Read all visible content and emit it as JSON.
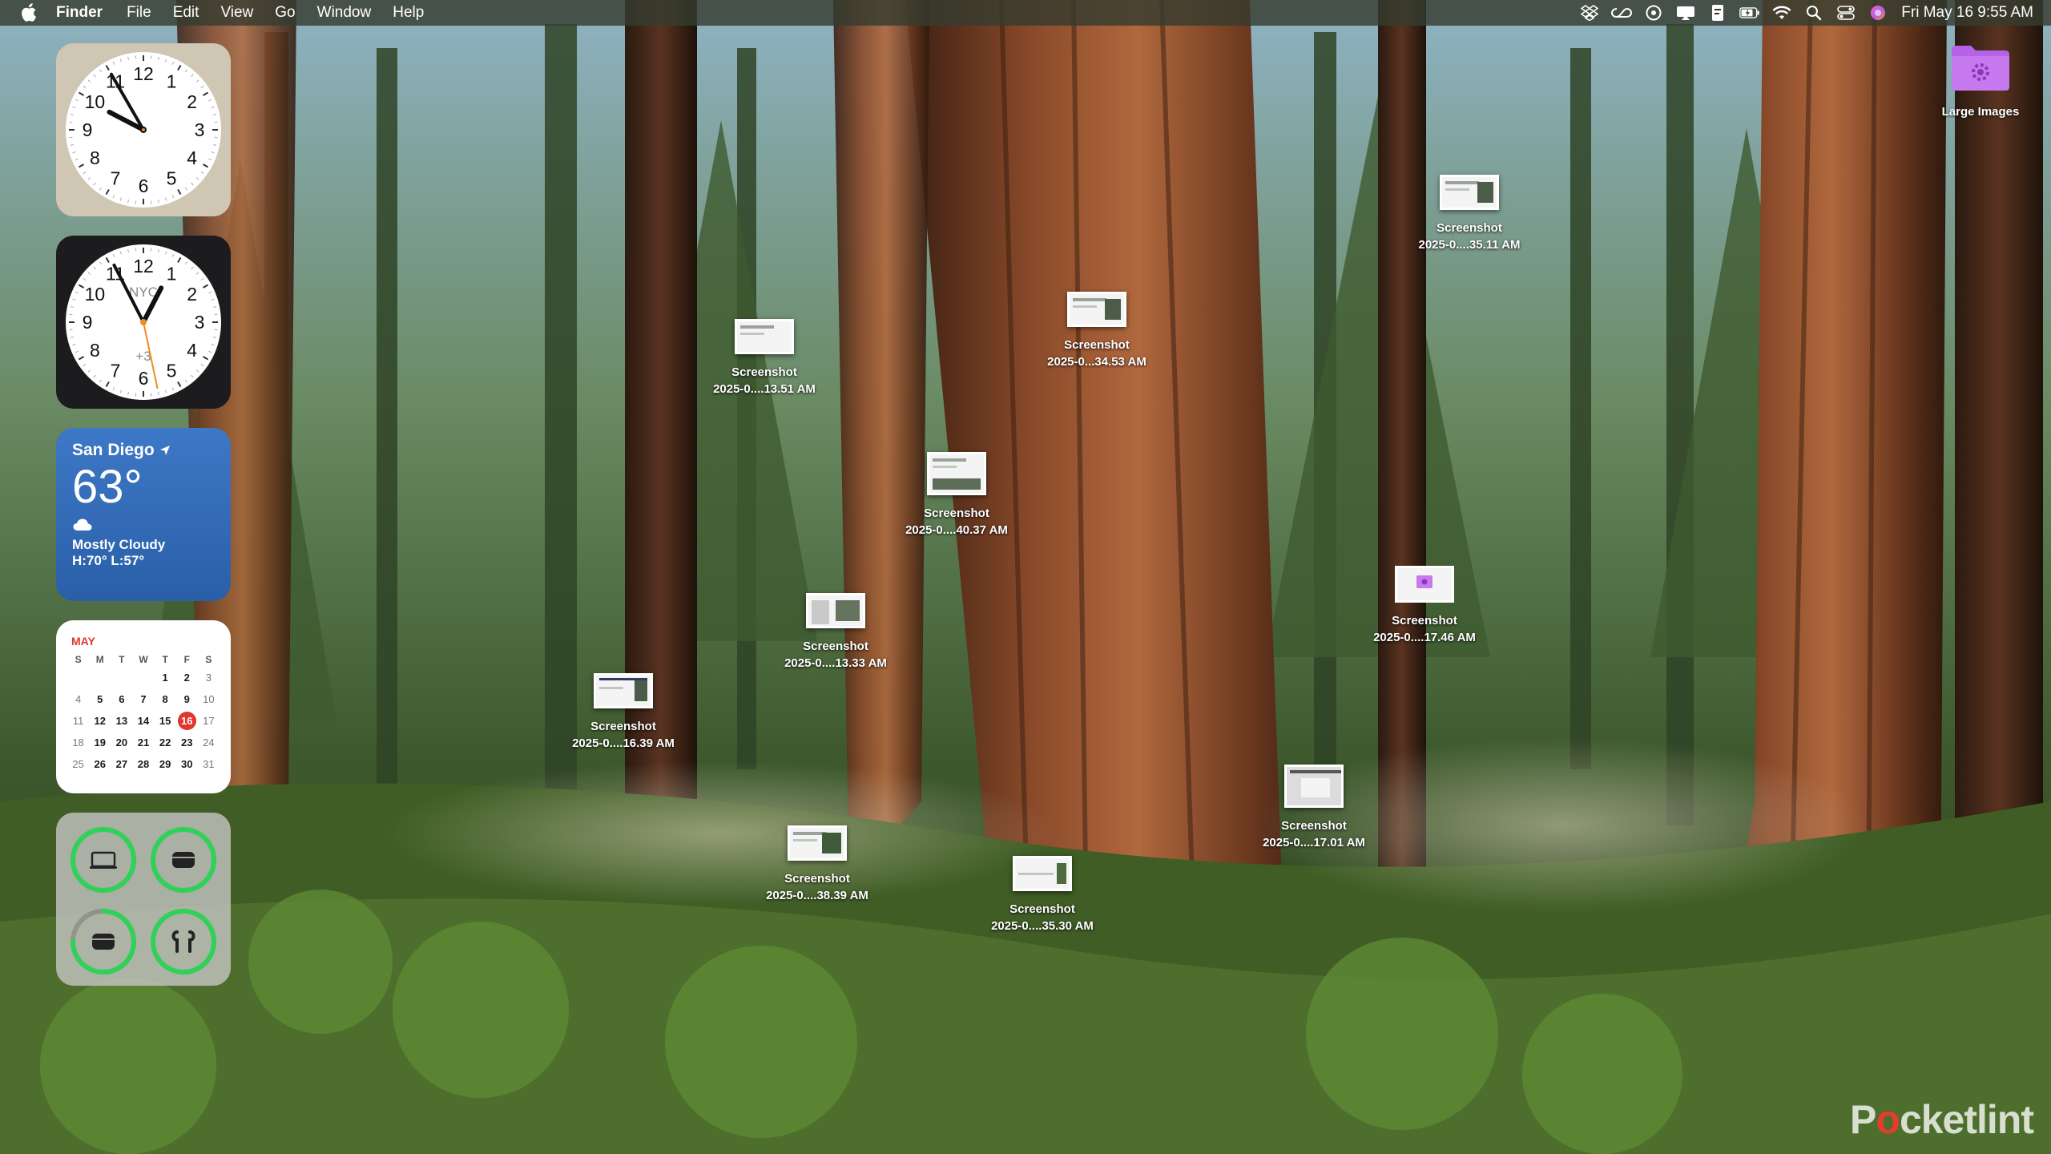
{
  "menubar": {
    "apple_icon": "apple-logo-icon",
    "app_name": "Finder",
    "menus": [
      "File",
      "Edit",
      "View",
      "Go",
      "Window",
      "Help"
    ],
    "status_icons": [
      "dropbox-icon",
      "creative-cloud-icon",
      "copilot-icon",
      "screen-mirroring-icon",
      "document-icon",
      "battery-charging-icon",
      "wifi-icon",
      "search-icon",
      "control-center-icon",
      "siri-icon"
    ],
    "datetime": "Fri May 16  9:55 AM"
  },
  "widgets": {
    "clock_local": {
      "hour": 9,
      "minute": 55,
      "second": 0
    },
    "clock_world": {
      "label": "NYC",
      "offset": "+3",
      "hour": 12,
      "minute": 55,
      "second": 28
    },
    "weather": {
      "city": "San Diego",
      "temperature": "63°",
      "condition": "Mostly Cloudy",
      "hilo": "H:70° L:57°"
    },
    "calendar": {
      "month": "MAY",
      "weekdays": [
        "S",
        "M",
        "T",
        "W",
        "T",
        "F",
        "S"
      ],
      "weeks": [
        [
          "",
          "",
          "",
          "",
          "1",
          "2",
          "3"
        ],
        [
          "4",
          "5",
          "6",
          "7",
          "8",
          "9",
          "10"
        ],
        [
          "11",
          "12",
          "13",
          "14",
          "15",
          "16",
          "17"
        ],
        [
          "18",
          "19",
          "20",
          "21",
          "22",
          "23",
          "24"
        ],
        [
          "25",
          "26",
          "27",
          "28",
          "29",
          "30",
          "31"
        ]
      ],
      "today": "16"
    },
    "batteries": [
      {
        "device": "laptop-icon",
        "level": 1.0
      },
      {
        "device": "airpods-case-icon",
        "level": 1.0
      },
      {
        "device": "airpods-case-icon",
        "level": 0.75
      },
      {
        "device": "airpods-icon",
        "level": 1.0
      }
    ]
  },
  "desktop": {
    "folder": {
      "name": "Large Images"
    },
    "screenshots": [
      {
        "line1": "Screenshot",
        "line2": "2025-0....35.11 AM"
      },
      {
        "line1": "Screenshot",
        "line2": "2025-0...34.53 AM"
      },
      {
        "line1": "Screenshot",
        "line2": "2025-0....13.51 AM"
      },
      {
        "line1": "Screenshot",
        "line2": "2025-0....40.37 AM"
      },
      {
        "line1": "Screenshot",
        "line2": "2025-0....17.46 AM"
      },
      {
        "line1": "Screenshot",
        "line2": "2025-0....13.33 AM"
      },
      {
        "line1": "Screenshot",
        "line2": "2025-0....16.39 AM"
      },
      {
        "line1": "Screenshot",
        "line2": "2025-0....17.01 AM"
      },
      {
        "line1": "Screenshot",
        "line2": "2025-0....38.39 AM"
      },
      {
        "line1": "Screenshot",
        "line2": "2025-0....35.30 AM"
      }
    ]
  },
  "watermark": {
    "pre": "P",
    "o": "o",
    "post": "cketlint"
  }
}
